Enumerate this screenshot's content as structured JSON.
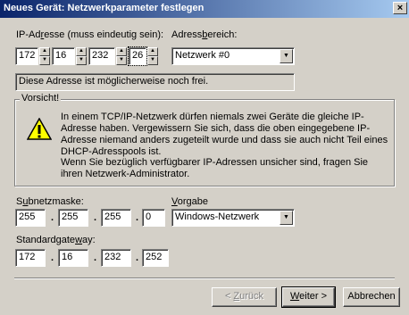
{
  "window": {
    "title": "Neues Gerät: Netzwerkparameter festlegen",
    "close_label": "×"
  },
  "ip": {
    "label_pre": "IP-Ad",
    "label_acc": "r",
    "label_post": "esse (muss eindeutig sein):",
    "octets": [
      "172",
      "16",
      "232",
      "26"
    ]
  },
  "range": {
    "label_pre": "Adress",
    "label_acc": "b",
    "label_post": "ereich:",
    "selected": "Netzwerk #0"
  },
  "status": {
    "text": "Diese Adresse ist möglicherweise noch frei."
  },
  "warning": {
    "group_label": "Vorsicht!",
    "paragraph1": "In einem TCP/IP-Netzwerk dürfen niemals zwei Geräte die gleiche IP-Adresse haben. Vergewissern Sie sich, dass die oben eingegebene IP-Adresse niemand anders zugeteilt wurde und dass sie auch nicht Teil eines DHCP-Adresspools ist.",
    "paragraph2": "Wenn Sie bezüglich verfügbarer IP-Adressen unsicher sind, fragen Sie ihren Netzwerk-Administrator."
  },
  "subnet": {
    "label_pre": "S",
    "label_acc": "u",
    "label_post": "bnetzmaske:",
    "octets": [
      "255",
      "255",
      "255",
      "0"
    ],
    "dot": "."
  },
  "preset": {
    "label_pre": "",
    "label_acc": "V",
    "label_post": "orgabe",
    "selected": "Windows-Netzwerk"
  },
  "gateway": {
    "label_pre": "Standardgate",
    "label_acc": "w",
    "label_post": "ay:",
    "octets": [
      "172",
      "16",
      "232",
      "252"
    ]
  },
  "buttons": {
    "back_pre": "< ",
    "back_acc": "Z",
    "back_post": "urück",
    "next_acc": "W",
    "next_post": "eiter >",
    "cancel": "Abbrechen"
  }
}
